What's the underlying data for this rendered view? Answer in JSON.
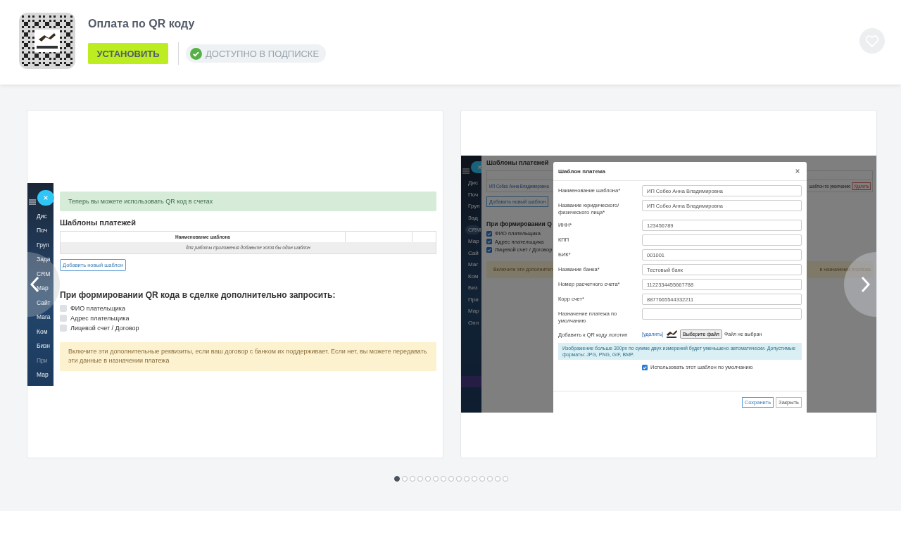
{
  "app": {
    "title": "Оплата по QR коду",
    "install_button": "УСТАНОВИТЬ",
    "subscription_badge": "ДОСТУПНО В ПОДПИСКЕ",
    "favorite": false
  },
  "slides": [
    {
      "kind": "settings",
      "sidebar": [
        {
          "label": "Дис",
          "disabled": false
        },
        {
          "label": "Поч",
          "disabled": false
        },
        {
          "label": "Груп",
          "disabled": false
        },
        {
          "label": "Зада",
          "disabled": false
        },
        {
          "label": "CRM",
          "disabled": false
        },
        {
          "label": "Мар",
          "disabled": false
        },
        {
          "label": "Сайт",
          "disabled": false
        },
        {
          "label": "Мага",
          "disabled": false
        },
        {
          "label": "Ком",
          "disabled": false
        },
        {
          "label": "Бизн",
          "disabled": false
        },
        {
          "label": "При",
          "disabled": true
        },
        {
          "label": "Мар",
          "disabled": false
        }
      ],
      "notice": "Теперь вы можете использовать QR код в счетах",
      "heading": "Шаблоны платежей",
      "table": {
        "column": "Наименование шаблона",
        "empty_text": "для работы приложения добавьте хотя бы один шаблон"
      },
      "add_button": "Добавить новый шаблон",
      "request_heading": "При формировании QR кода в сделке дополнительно запросить:",
      "options": [
        {
          "label": "ФИО плательщика",
          "checked": false
        },
        {
          "label": "Адрес плательщика",
          "checked": false
        },
        {
          "label": "Лицевой счет / Договор",
          "checked": false
        }
      ],
      "warning": "Включите эти дополнительные реквизиты, если ваш договор с банком их поддерживает. Если нет, вы можете передавать эти данные в назначении платежа"
    },
    {
      "kind": "modal",
      "sidebar": [
        {
          "label": "Дис",
          "selected": false
        },
        {
          "label": "Поч",
          "selected": false
        },
        {
          "label": "Груп",
          "selected": false
        },
        {
          "label": "Зад",
          "selected": false
        },
        {
          "label": "CRM",
          "selected": true
        },
        {
          "label": "Мар",
          "selected": false
        },
        {
          "label": "Сай",
          "selected": false
        },
        {
          "label": "Маг",
          "selected": false
        },
        {
          "label": "Ком",
          "selected": false
        },
        {
          "label": "Биз",
          "selected": false
        },
        {
          "label": "При",
          "selected": false
        },
        {
          "label": "Мар",
          "selected": false
        },
        {
          "label": "Опл",
          "selected": false
        }
      ],
      "background": {
        "heading": "Шаблоны платежей",
        "template_name": "ИП Собко Анна Владимировна",
        "default_label": "шаблон по умолчанию",
        "delete_button": "Удалить",
        "add_button": "Добавить новый шаблон",
        "request_heading": "При формировании Q",
        "options": [
          {
            "label": "ФИО плательщика",
            "checked": true
          },
          {
            "label": "Адрес плательщика",
            "checked": true
          },
          {
            "label": "Лицевой счет / Договор",
            "checked": true
          }
        ],
        "warning_start": "Включите эти дополнител",
        "warning_end": "в назначении платежа"
      },
      "modal": {
        "title": "Шаблон платежа",
        "fields": [
          {
            "label": "Наименование шаблона*",
            "value": "ИП Собко Анна Владимировна"
          },
          {
            "label": "Название юридического/ физического лица*",
            "value": "ИП Собко Анна Владимировна"
          },
          {
            "label": "ИНН*",
            "value": "123456789"
          },
          {
            "label": "КПП"
          },
          {
            "label": "БИК*",
            "value": "001001"
          },
          {
            "label": "Название банка*",
            "value": "Тестовый банк"
          },
          {
            "label": "Номер расчетного счета*",
            "value": "1122334455667788"
          },
          {
            "label": "Корр счет*",
            "value": "8877665544332211"
          },
          {
            "label": "Назначение платежа по умолчанию"
          }
        ],
        "logo_label": "Добавить к QR коду логотип",
        "delete_link": "[удалить]",
        "file_button": "Выберите файл",
        "file_status": "Файл не выбран",
        "hint": "Изображение больше 300px по сумме двух измерений будет уменьшено автоматически. Допустимые форматы: JPG, PNG, GIF, BMP.",
        "default_option": {
          "label": "Использовать этот шаблон по умолчанию",
          "checked": true
        },
        "buttons": [
          "Сохранить",
          "Закрыть"
        ]
      }
    }
  ],
  "pagination": [
    {
      "selected": true
    },
    {
      "selected": false
    },
    {
      "selected": false
    },
    {
      "selected": false
    },
    {
      "selected": false
    },
    {
      "selected": false
    },
    {
      "selected": false
    },
    {
      "selected": false
    },
    {
      "selected": false
    },
    {
      "selected": false
    },
    {
      "selected": false
    },
    {
      "selected": false
    },
    {
      "selected": false
    },
    {
      "selected": false
    },
    {
      "selected": false
    }
  ]
}
